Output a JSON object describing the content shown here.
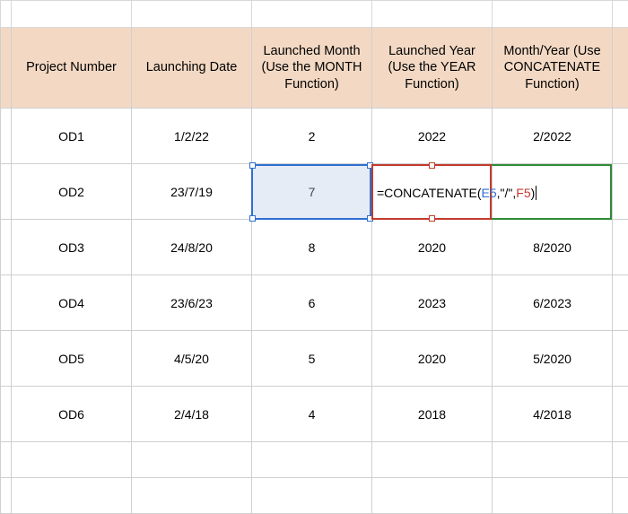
{
  "headers": {
    "c1": "Project Number",
    "c2": "Launching Date",
    "c3": "Launched Month (Use the MONTH Function)",
    "c4": "Launched Year (Use the YEAR Function)",
    "c5": "Month/Year (Use CONCATENATE Function)"
  },
  "rows": [
    {
      "project": "OD1",
      "date": "1/2/22",
      "month": "2",
      "year": "2022",
      "my": "2/2022"
    },
    {
      "project": "OD2",
      "date": "23/7/19",
      "month": "7",
      "year": "",
      "my": ""
    },
    {
      "project": "OD3",
      "date": "24/8/20",
      "month": "8",
      "year": "2020",
      "my": "8/2020"
    },
    {
      "project": "OD4",
      "date": "23/6/23",
      "month": "6",
      "year": "2023",
      "my": "6/2023"
    },
    {
      "project": "OD5",
      "date": "4/5/20",
      "month": "5",
      "year": "2020",
      "my": "5/2020"
    },
    {
      "project": "OD6",
      "date": "2/4/18",
      "month": "4",
      "year": "2018",
      "my": "4/2018"
    }
  ],
  "formula": {
    "prefix": "=CONCATENATE(",
    "ref1": "E5",
    "mid": ",\"/\",",
    "ref2": "F5",
    "suffix": ")"
  }
}
